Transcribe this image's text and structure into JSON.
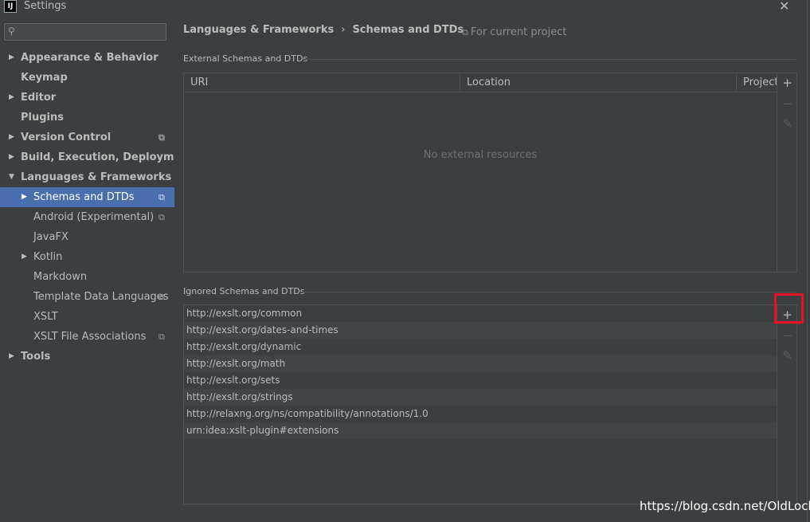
{
  "window": {
    "title": "Settings",
    "app_icon_text": "IJ",
    "close_glyph": "✕"
  },
  "sidebar": {
    "search_placeholder": "",
    "items": [
      {
        "label": "Appearance & Behavior",
        "arrow": "▶",
        "bold": true
      },
      {
        "label": "Keymap",
        "arrow": "",
        "bold": true
      },
      {
        "label": "Editor",
        "arrow": "▶",
        "bold": true
      },
      {
        "label": "Plugins",
        "arrow": "",
        "bold": true
      },
      {
        "label": "Version Control",
        "arrow": "▶",
        "bold": true,
        "copy": "⧉"
      },
      {
        "label": "Build, Execution, Deployment",
        "arrow": "▶",
        "bold": true
      },
      {
        "label": "Languages & Frameworks",
        "arrow": "▼",
        "bold": true
      },
      {
        "label": "Schemas and DTDs",
        "arrow": "▶",
        "bold": false,
        "copy": "⧉",
        "selected": true
      },
      {
        "label": "Android (Experimental)",
        "arrow": "",
        "bold": false,
        "copy": "⧉"
      },
      {
        "label": "JavaFX",
        "arrow": "",
        "bold": false
      },
      {
        "label": "Kotlin",
        "arrow": "▶",
        "bold": false
      },
      {
        "label": "Markdown",
        "arrow": "",
        "bold": false
      },
      {
        "label": "Template Data Languages",
        "arrow": "",
        "bold": false,
        "copy": "⧉"
      },
      {
        "label": "XSLT",
        "arrow": "",
        "bold": false
      },
      {
        "label": "XSLT File Associations",
        "arrow": "",
        "bold": false,
        "copy": "⧉"
      },
      {
        "label": "Tools",
        "arrow": "▶",
        "bold": true
      }
    ]
  },
  "main": {
    "breadcrumb": {
      "parent": "Languages & Frameworks",
      "separator": "›",
      "current": "Schemas and DTDs"
    },
    "scope": {
      "icon": "⧉",
      "label": "For current project"
    },
    "external": {
      "title": "External Schemas and DTDs",
      "columns": [
        "URI",
        "Location",
        "Project"
      ],
      "empty_text": "No external resources",
      "tools": {
        "add": "+",
        "remove": "−",
        "edit": "✎"
      }
    },
    "ignored": {
      "title": "Ignored Schemas and DTDs",
      "items": [
        "http://exslt.org/common",
        "http://exslt.org/dates-and-times",
        "http://exslt.org/dynamic",
        "http://exslt.org/math",
        "http://exslt.org/sets",
        "http://exslt.org/strings",
        "http://relaxng.org/ns/compatibility/annotations/1.0",
        "urn:idea:xslt-plugin#extensions"
      ],
      "tools": {
        "add": "+",
        "remove": "−",
        "edit": "✎"
      }
    }
  },
  "watermark": "https://blog.csdn.net/OldLock",
  "colors": {
    "background": "#3c3f41",
    "selection": "#4b6eaf",
    "highlight_box": "#e81123"
  }
}
